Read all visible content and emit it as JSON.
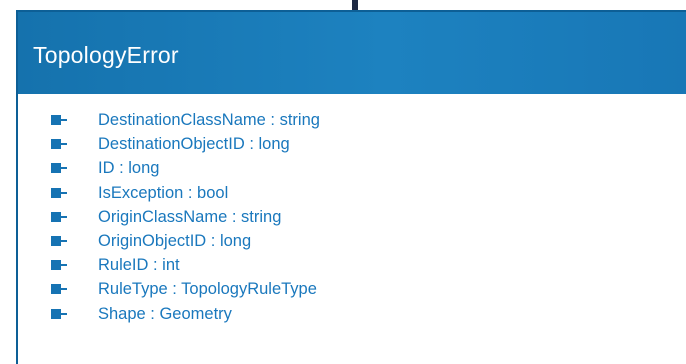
{
  "class": {
    "name": "TopologyError",
    "members": [
      {
        "text": "DestinationClassName : string"
      },
      {
        "text": "DestinationObjectID : long"
      },
      {
        "text": "ID : long"
      },
      {
        "text": "IsException : bool"
      },
      {
        "text": "OriginClassName : string"
      },
      {
        "text": "OriginObjectID : long"
      },
      {
        "text": "RuleID : int"
      },
      {
        "text": "RuleType : TopologyRuleType"
      },
      {
        "text": "Shape : Geometry"
      }
    ]
  },
  "colors": {
    "header": "#1a7cbc",
    "member_text": "#1a78bd",
    "member_icon": "#1673b3",
    "connector": "#1f2a44"
  },
  "icons": {
    "member": "property-icon"
  }
}
